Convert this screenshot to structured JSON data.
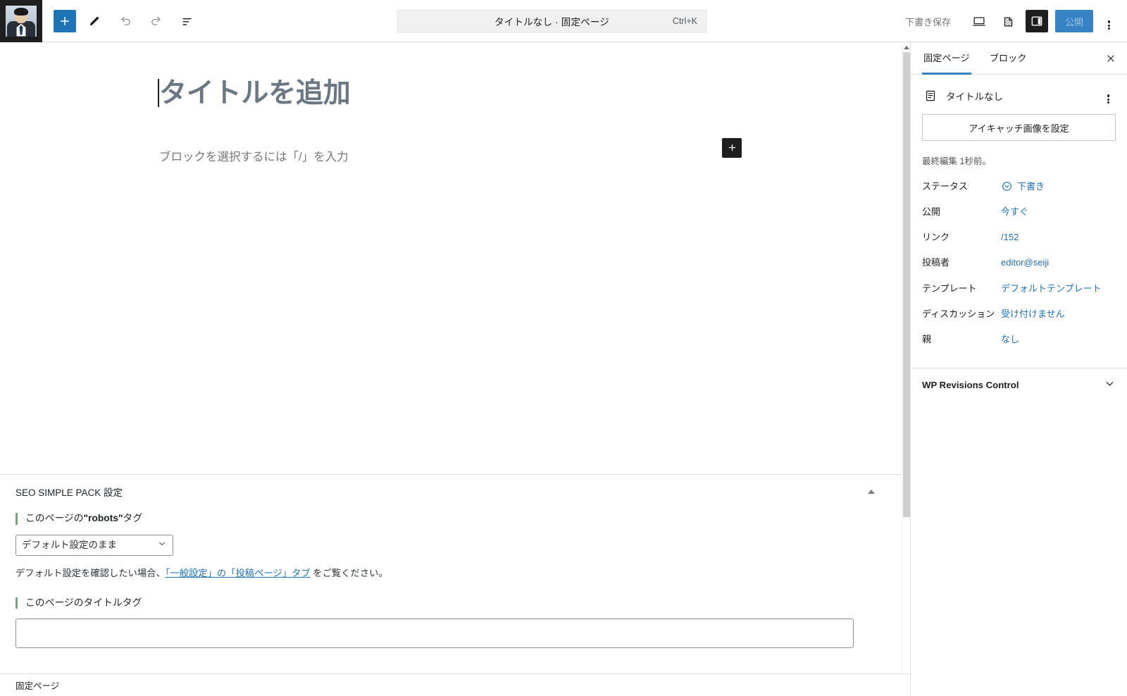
{
  "topbar": {
    "site_icon_name": "site-avatar",
    "add_block_label": "+",
    "tools_label": "ツール",
    "undo_label": "元に戻す",
    "redo_label": "やり直し",
    "list_view_label": "リスト表示",
    "command_bar": {
      "title": "タイトルなし · 固定ページ",
      "shortcut": "Ctrl+K"
    },
    "save_draft_label": "下書き保存",
    "preview_label": "プレビュー",
    "view_label": "表示",
    "settings_toggle_label": "設定",
    "publish_label": "公開",
    "options_label": "オプション"
  },
  "editor": {
    "title_placeholder": "タイトルを追加",
    "block_placeholder": "ブロックを選択するには「/」を入力",
    "appender_label": "+"
  },
  "metabox": {
    "title": "SEO SIMPLE PACK 設定",
    "collapse_label": "折りたたむ",
    "fields": [
      {
        "label_prefix": "このページの",
        "label_bold": "\"robots\"",
        "label_suffix": "タグ",
        "select_value": "デフォルト設定のまま",
        "options": [
          "デフォルト設定のまま"
        ],
        "helper_pre": "デフォルト設定を確認したい場合、",
        "helper_link": "「一般設定」の「投稿ページ」タブ",
        "helper_post": " をご覧ください。"
      },
      {
        "label_full": "このページのタイトルタグ",
        "input_value": "",
        "input_placeholder": ""
      }
    ]
  },
  "sidebar": {
    "tabs": [
      {
        "label": "固定ページ",
        "active": true
      },
      {
        "label": "ブロック",
        "active": false
      }
    ],
    "close_label": "✕",
    "document": {
      "icon": "page-icon",
      "title": "タイトルなし",
      "actions_label": "⋮"
    },
    "featured_image_label": "アイキャッチ画像を設定",
    "last_edited": "最終編集 1秒前。",
    "meta_rows": [
      {
        "key": "ステータス",
        "value": "下書き",
        "icon": "status-draft-icon"
      },
      {
        "key": "公開",
        "value": "今すぐ",
        "icon": ""
      },
      {
        "key": "リンク",
        "value": "/152",
        "icon": ""
      },
      {
        "key": "投稿者",
        "value": "editor@seiji",
        "icon": ""
      },
      {
        "key": "テンプレート",
        "value": "デフォルトテンプレート",
        "icon": ""
      },
      {
        "key": "ディスカッション",
        "value": "受け付けません",
        "icon": ""
      },
      {
        "key": "親",
        "value": "なし",
        "icon": ""
      }
    ],
    "panels": [
      {
        "title": "WP Revisions Control",
        "expanded": false
      }
    ]
  },
  "statusbar": {
    "label": "固定ページ"
  },
  "colors": {
    "accent_blue": "#3582c4",
    "link_blue": "#2271b1",
    "add_block_blue": "#1e74b4",
    "dark": "#1e1e1e",
    "border": "#e0e0e0",
    "title_gray": "#6b7783",
    "field_accent_green": "#7ba27b"
  }
}
